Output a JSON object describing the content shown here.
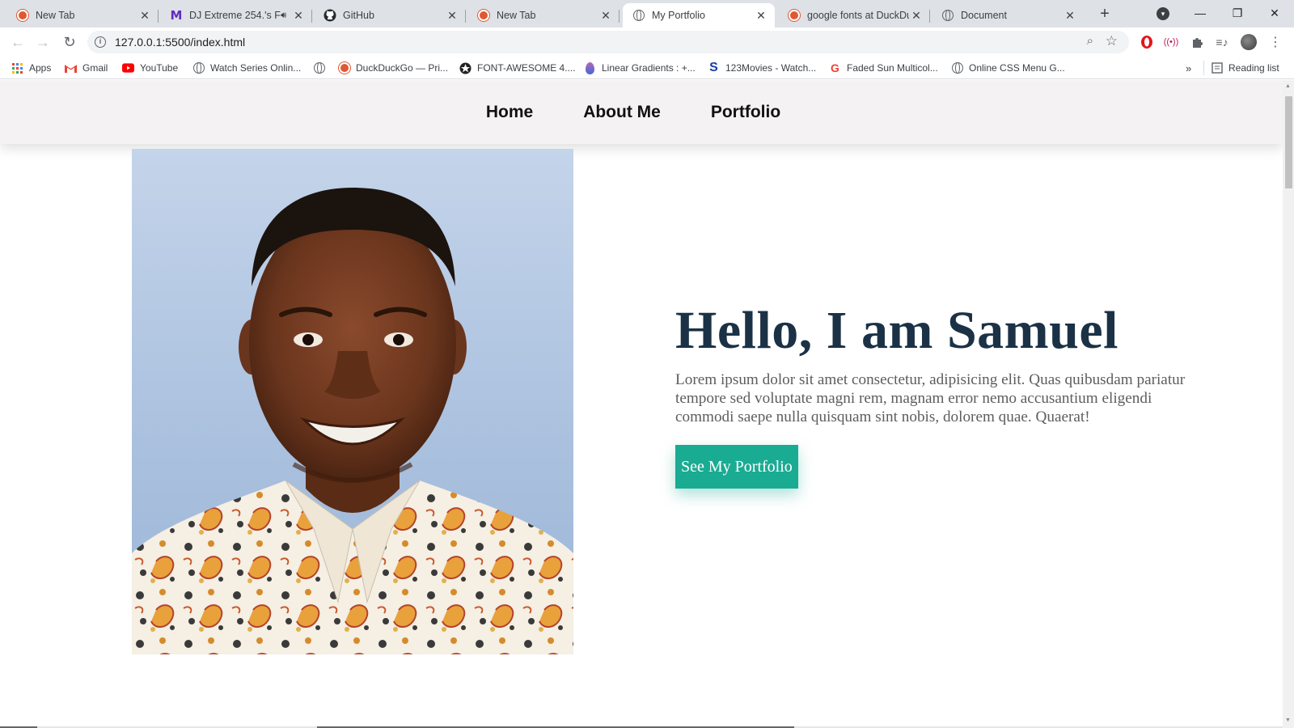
{
  "browser": {
    "tabs": [
      {
        "title": "New Tab",
        "icon": "duckduckgo-icon"
      },
      {
        "title": "DJ Extreme 254.'s F",
        "icon": "mixcloud-icon"
      },
      {
        "title": "GitHub",
        "icon": "github-icon"
      },
      {
        "title": "New Tab",
        "icon": "duckduckgo-icon"
      },
      {
        "title": "My Portfolio",
        "icon": "globe-icon",
        "active": true
      },
      {
        "title": "google fonts at DuckDu",
        "icon": "duckduckgo-icon"
      },
      {
        "title": "Document",
        "icon": "globe-icon"
      }
    ],
    "url": "127.0.0.1:5500/index.html",
    "bookmarks": [
      {
        "label": "Apps",
        "icon": "apps-grid-icon"
      },
      {
        "label": "Gmail",
        "icon": "gmail-icon"
      },
      {
        "label": "YouTube",
        "icon": "youtube-icon"
      },
      {
        "label": "Watch Series Onlin...",
        "icon": "globe-icon"
      },
      {
        "label": "",
        "icon": "globe-icon"
      },
      {
        "label": "DuckDuckGo — Pri...",
        "icon": "duckduckgo-icon"
      },
      {
        "label": "FONT-AWESOME 4....",
        "icon": "font-awesome-icon"
      },
      {
        "label": "Linear Gradients : +...",
        "icon": "gradient-icon"
      },
      {
        "label": "123Movies - Watch...",
        "icon": "s-logo-icon"
      },
      {
        "label": "Faded Sun Multicol...",
        "icon": "google-icon"
      },
      {
        "label": "Online CSS Menu G...",
        "icon": "globe-icon"
      }
    ],
    "reading_list": "Reading list",
    "colors": {
      "chrome_bg": "#dee1e6",
      "accent": "#1aab93",
      "title_color": "#1b3146"
    }
  },
  "site": {
    "nav": [
      {
        "label": "Home"
      },
      {
        "label": "About Me"
      },
      {
        "label": "Portfolio"
      }
    ],
    "hero": {
      "title": "Hello, I am Samuel",
      "body": "Lorem ipsum dolor sit amet consectetur, adipisicing elit. Quas quibusdam pariatur tempore sed voluptate magni rem, magnam error nemo accusantium eligendi commodi saepe nulla quisquam sint nobis, dolorem quae. Quaerat!",
      "button_label": "See My Portfolio"
    }
  }
}
